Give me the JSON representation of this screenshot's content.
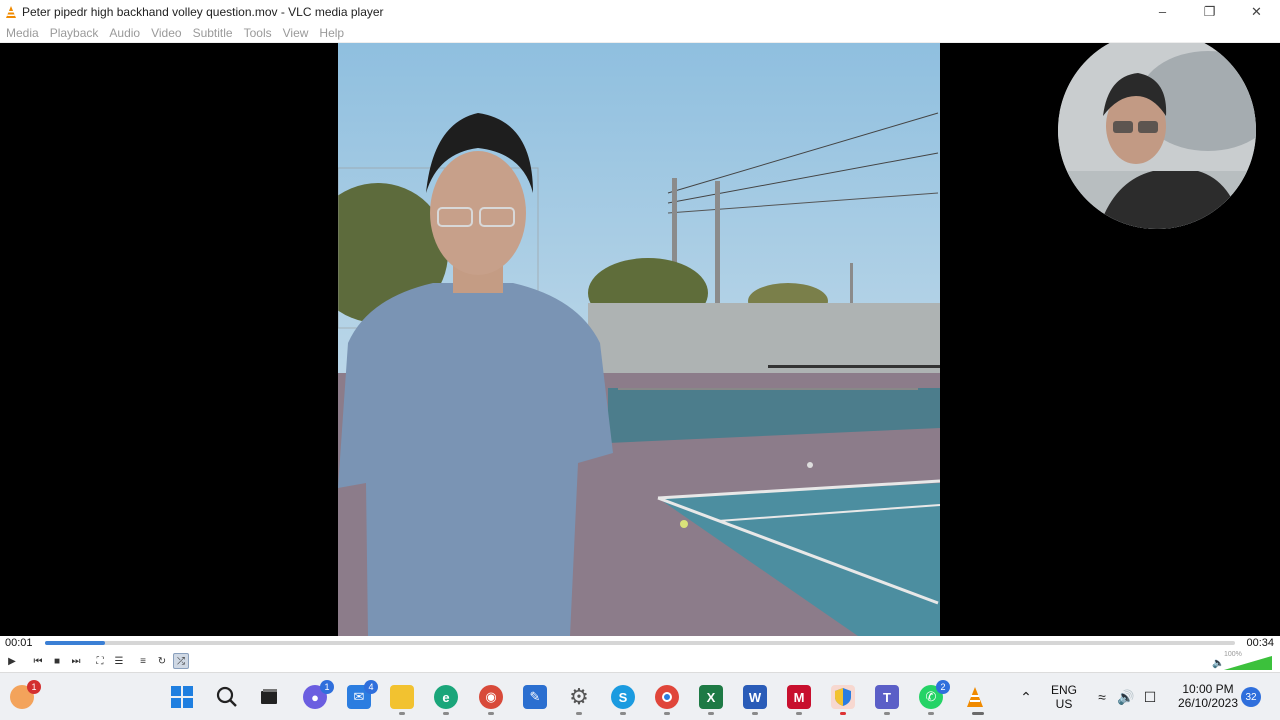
{
  "window": {
    "title": "Peter pipedr high backhand volley question.mov - VLC media player",
    "minimize_icon": "minimize-icon",
    "maximize_icon": "maximize-icon",
    "close_icon": "close-icon"
  },
  "menu": {
    "items": [
      "Media",
      "Playback",
      "Audio",
      "Video",
      "Subtitle",
      "Tools",
      "View",
      "Help"
    ]
  },
  "player": {
    "elapsed": "00:01",
    "duration": "00:34",
    "progress": 0.05,
    "volume_label": "100%",
    "volume": 1.0
  },
  "controls": {
    "play": "play-icon",
    "previous": "previous-icon",
    "stop": "stop-icon",
    "next": "next-icon",
    "fullscreen": "fullscreen-icon",
    "extended": "extended-settings-icon",
    "playlist": "playlist-icon",
    "loop": "loop-icon",
    "random": "random-icon"
  },
  "taskbar": {
    "weather_badge": "1",
    "teams_badge": "1",
    "mail_badge": "4",
    "whatsapp_badge": "2",
    "language_line1": "ENG",
    "language_line2": "US",
    "time": "10:00 PM",
    "date": "26/10/2023",
    "notification_count": "32"
  },
  "colors": {
    "accent": "#3a7fd5",
    "vlc_orange": "#f08a00",
    "volume_green": "#3cc13c",
    "badge_red": "#d32f2f",
    "badge_blue": "#2f6fdc"
  }
}
